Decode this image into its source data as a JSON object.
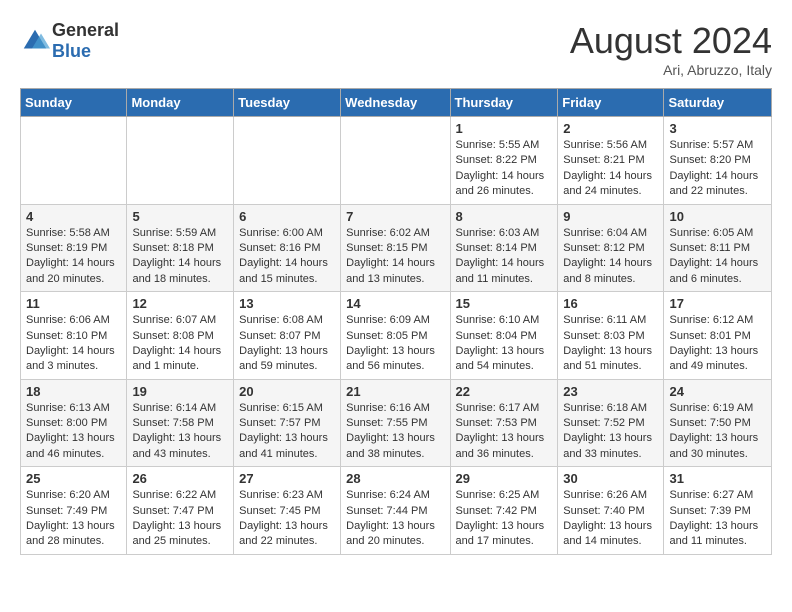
{
  "logo": {
    "general": "General",
    "blue": "Blue"
  },
  "title": "August 2024",
  "location": "Ari, Abruzzo, Italy",
  "days_of_week": [
    "Sunday",
    "Monday",
    "Tuesday",
    "Wednesday",
    "Thursday",
    "Friday",
    "Saturday"
  ],
  "weeks": [
    [
      {
        "day": "",
        "info": ""
      },
      {
        "day": "",
        "info": ""
      },
      {
        "day": "",
        "info": ""
      },
      {
        "day": "",
        "info": ""
      },
      {
        "day": "1",
        "info": "Sunrise: 5:55 AM\nSunset: 8:22 PM\nDaylight: 14 hours and 26 minutes."
      },
      {
        "day": "2",
        "info": "Sunrise: 5:56 AM\nSunset: 8:21 PM\nDaylight: 14 hours and 24 minutes."
      },
      {
        "day": "3",
        "info": "Sunrise: 5:57 AM\nSunset: 8:20 PM\nDaylight: 14 hours and 22 minutes."
      }
    ],
    [
      {
        "day": "4",
        "info": "Sunrise: 5:58 AM\nSunset: 8:19 PM\nDaylight: 14 hours and 20 minutes."
      },
      {
        "day": "5",
        "info": "Sunrise: 5:59 AM\nSunset: 8:18 PM\nDaylight: 14 hours and 18 minutes."
      },
      {
        "day": "6",
        "info": "Sunrise: 6:00 AM\nSunset: 8:16 PM\nDaylight: 14 hours and 15 minutes."
      },
      {
        "day": "7",
        "info": "Sunrise: 6:02 AM\nSunset: 8:15 PM\nDaylight: 14 hours and 13 minutes."
      },
      {
        "day": "8",
        "info": "Sunrise: 6:03 AM\nSunset: 8:14 PM\nDaylight: 14 hours and 11 minutes."
      },
      {
        "day": "9",
        "info": "Sunrise: 6:04 AM\nSunset: 8:12 PM\nDaylight: 14 hours and 8 minutes."
      },
      {
        "day": "10",
        "info": "Sunrise: 6:05 AM\nSunset: 8:11 PM\nDaylight: 14 hours and 6 minutes."
      }
    ],
    [
      {
        "day": "11",
        "info": "Sunrise: 6:06 AM\nSunset: 8:10 PM\nDaylight: 14 hours and 3 minutes."
      },
      {
        "day": "12",
        "info": "Sunrise: 6:07 AM\nSunset: 8:08 PM\nDaylight: 14 hours and 1 minute."
      },
      {
        "day": "13",
        "info": "Sunrise: 6:08 AM\nSunset: 8:07 PM\nDaylight: 13 hours and 59 minutes."
      },
      {
        "day": "14",
        "info": "Sunrise: 6:09 AM\nSunset: 8:05 PM\nDaylight: 13 hours and 56 minutes."
      },
      {
        "day": "15",
        "info": "Sunrise: 6:10 AM\nSunset: 8:04 PM\nDaylight: 13 hours and 54 minutes."
      },
      {
        "day": "16",
        "info": "Sunrise: 6:11 AM\nSunset: 8:03 PM\nDaylight: 13 hours and 51 minutes."
      },
      {
        "day": "17",
        "info": "Sunrise: 6:12 AM\nSunset: 8:01 PM\nDaylight: 13 hours and 49 minutes."
      }
    ],
    [
      {
        "day": "18",
        "info": "Sunrise: 6:13 AM\nSunset: 8:00 PM\nDaylight: 13 hours and 46 minutes."
      },
      {
        "day": "19",
        "info": "Sunrise: 6:14 AM\nSunset: 7:58 PM\nDaylight: 13 hours and 43 minutes."
      },
      {
        "day": "20",
        "info": "Sunrise: 6:15 AM\nSunset: 7:57 PM\nDaylight: 13 hours and 41 minutes."
      },
      {
        "day": "21",
        "info": "Sunrise: 6:16 AM\nSunset: 7:55 PM\nDaylight: 13 hours and 38 minutes."
      },
      {
        "day": "22",
        "info": "Sunrise: 6:17 AM\nSunset: 7:53 PM\nDaylight: 13 hours and 36 minutes."
      },
      {
        "day": "23",
        "info": "Sunrise: 6:18 AM\nSunset: 7:52 PM\nDaylight: 13 hours and 33 minutes."
      },
      {
        "day": "24",
        "info": "Sunrise: 6:19 AM\nSunset: 7:50 PM\nDaylight: 13 hours and 30 minutes."
      }
    ],
    [
      {
        "day": "25",
        "info": "Sunrise: 6:20 AM\nSunset: 7:49 PM\nDaylight: 13 hours and 28 minutes."
      },
      {
        "day": "26",
        "info": "Sunrise: 6:22 AM\nSunset: 7:47 PM\nDaylight: 13 hours and 25 minutes."
      },
      {
        "day": "27",
        "info": "Sunrise: 6:23 AM\nSunset: 7:45 PM\nDaylight: 13 hours and 22 minutes."
      },
      {
        "day": "28",
        "info": "Sunrise: 6:24 AM\nSunset: 7:44 PM\nDaylight: 13 hours and 20 minutes."
      },
      {
        "day": "29",
        "info": "Sunrise: 6:25 AM\nSunset: 7:42 PM\nDaylight: 13 hours and 17 minutes."
      },
      {
        "day": "30",
        "info": "Sunrise: 6:26 AM\nSunset: 7:40 PM\nDaylight: 13 hours and 14 minutes."
      },
      {
        "day": "31",
        "info": "Sunrise: 6:27 AM\nSunset: 7:39 PM\nDaylight: 13 hours and 11 minutes."
      }
    ]
  ]
}
